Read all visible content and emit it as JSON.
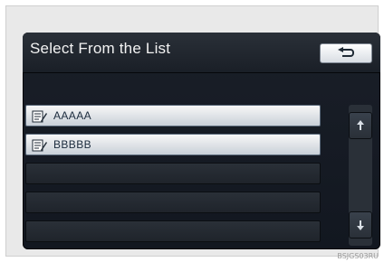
{
  "header": {
    "title": "Select From the List"
  },
  "list": {
    "items": [
      {
        "label": "AAAAA"
      },
      {
        "label": "BBBBB"
      }
    ]
  },
  "footer": {
    "image_code": "BSJGS03RU"
  },
  "colors": {
    "screen_bg": "#121720",
    "row_active": "#e8edf2",
    "row_empty": "#242a32",
    "text_dark": "#1b2b3d",
    "text_light": "#f2f2f2"
  },
  "icons": {
    "back": "back-arrow-icon",
    "item": "note-edit-icon",
    "scroll_up": "scroll-up-icon",
    "scroll_down": "scroll-down-icon"
  }
}
